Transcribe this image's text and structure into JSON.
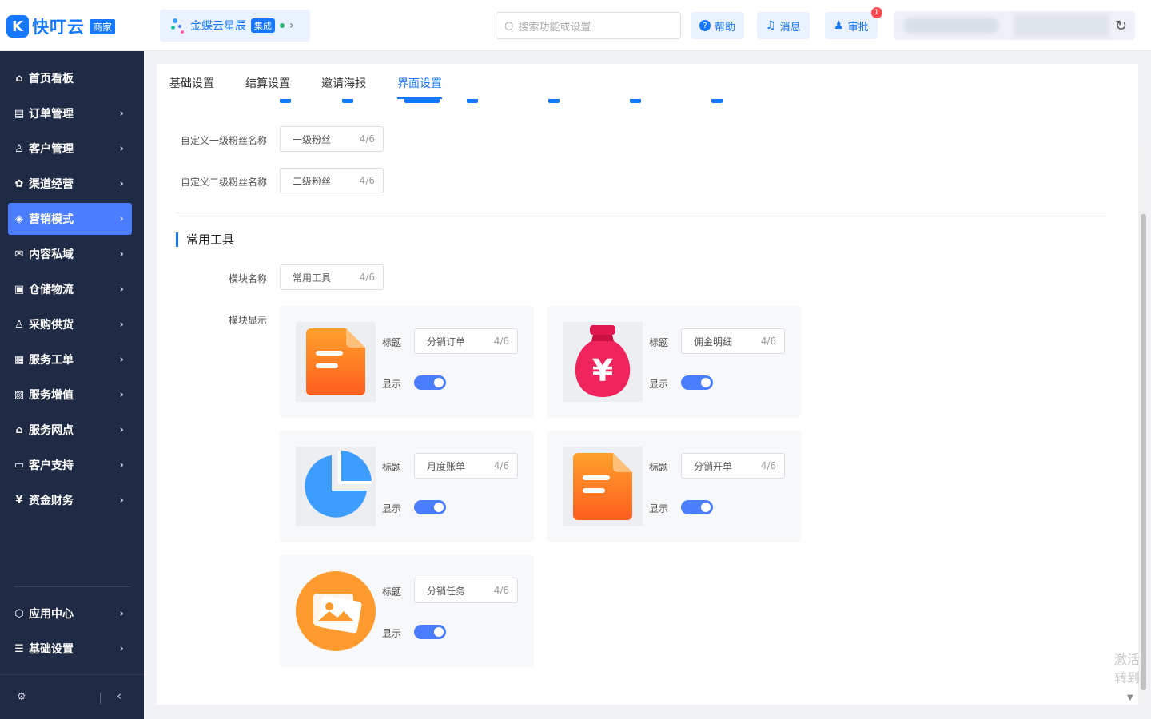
{
  "brand": {
    "logo_mark": "K",
    "name": "快叮云",
    "tag": "商家"
  },
  "store": {
    "name": "金蝶云星辰",
    "tag": "集成"
  },
  "search": {
    "placeholder": "搜索功能或设置"
  },
  "top_actions": {
    "help": "帮助",
    "messages": "消息",
    "approval": "审批",
    "approval_badge": "1"
  },
  "sidebar": {
    "items": [
      {
        "icon": "home-icon",
        "glyph": "⌂",
        "label": "首页看板",
        "arrow": false
      },
      {
        "icon": "order-icon",
        "glyph": "▤",
        "label": "订单管理",
        "arrow": true
      },
      {
        "icon": "customer-icon",
        "glyph": "♙",
        "label": "客户管理",
        "arrow": true
      },
      {
        "icon": "channel-icon",
        "glyph": "✿",
        "label": "渠道经营",
        "arrow": true
      },
      {
        "icon": "tag-icon",
        "glyph": "◈",
        "label": "营销模式",
        "arrow": true,
        "active": true
      },
      {
        "icon": "mail-icon",
        "glyph": "✉",
        "label": "内容私域",
        "arrow": true
      },
      {
        "icon": "warehouse-icon",
        "glyph": "▣",
        "label": "仓储物流",
        "arrow": true
      },
      {
        "icon": "purchase-icon",
        "glyph": "♙",
        "label": "采购供货",
        "arrow": true
      },
      {
        "icon": "workorder-icon",
        "glyph": "▦",
        "label": "服务工单",
        "arrow": true
      },
      {
        "icon": "gift-icon",
        "glyph": "▨",
        "label": "服务增值",
        "arrow": true
      },
      {
        "icon": "outlet-icon",
        "glyph": "⌂",
        "label": "服务网点",
        "arrow": true
      },
      {
        "icon": "support-icon",
        "glyph": "▭",
        "label": "客户支持",
        "arrow": true
      },
      {
        "icon": "finance-icon",
        "glyph": "¥",
        "label": "资金财务",
        "arrow": true
      }
    ],
    "bottom_items": [
      {
        "icon": "app-center-icon",
        "glyph": "⬡",
        "label": "应用中心"
      },
      {
        "icon": "settings-list-icon",
        "glyph": "☰",
        "label": "基础设置"
      }
    ]
  },
  "tabs": [
    {
      "label": "基础设置",
      "active": false
    },
    {
      "label": "结算设置",
      "active": false
    },
    {
      "label": "邀请海报",
      "active": false
    },
    {
      "label": "界面设置",
      "active": true
    }
  ],
  "fan_fields": [
    {
      "label": "自定义一级粉丝名称",
      "value": "一级粉丝",
      "count": "4/6"
    },
    {
      "label": "自定义二级粉丝名称",
      "value": "二级粉丝",
      "count": "4/6"
    }
  ],
  "tools_section": {
    "title": "常用工具",
    "module_name_label": "模块名称",
    "module_name_value": "常用工具",
    "module_name_count": "4/6",
    "module_display_label": "模块显示",
    "title_label": "标题",
    "show_label": "显示",
    "cards": [
      {
        "icon": "document-icon",
        "title": "分销订单",
        "count": "4/6",
        "enabled": true
      },
      {
        "icon": "money-bag-icon",
        "title": "佣金明细",
        "count": "4/6",
        "enabled": true
      },
      {
        "icon": "pie-chart-icon",
        "title": "月度账单",
        "count": "4/6",
        "enabled": true
      },
      {
        "icon": "document-icon",
        "title": "分销开单",
        "count": "4/6",
        "enabled": true
      },
      {
        "icon": "image-icon",
        "title": "分销任务",
        "count": "4/6",
        "enabled": true
      }
    ]
  },
  "watermark": {
    "line1": "激活",
    "line2": "转到"
  },
  "colors": {
    "primary": "#1677ff",
    "sidebar_bg": "#1f2a44",
    "active_nav": "#4a7dff",
    "orange": "#ff7a1a",
    "pink": "#f0245c",
    "blue_pie": "#3c9dff"
  }
}
